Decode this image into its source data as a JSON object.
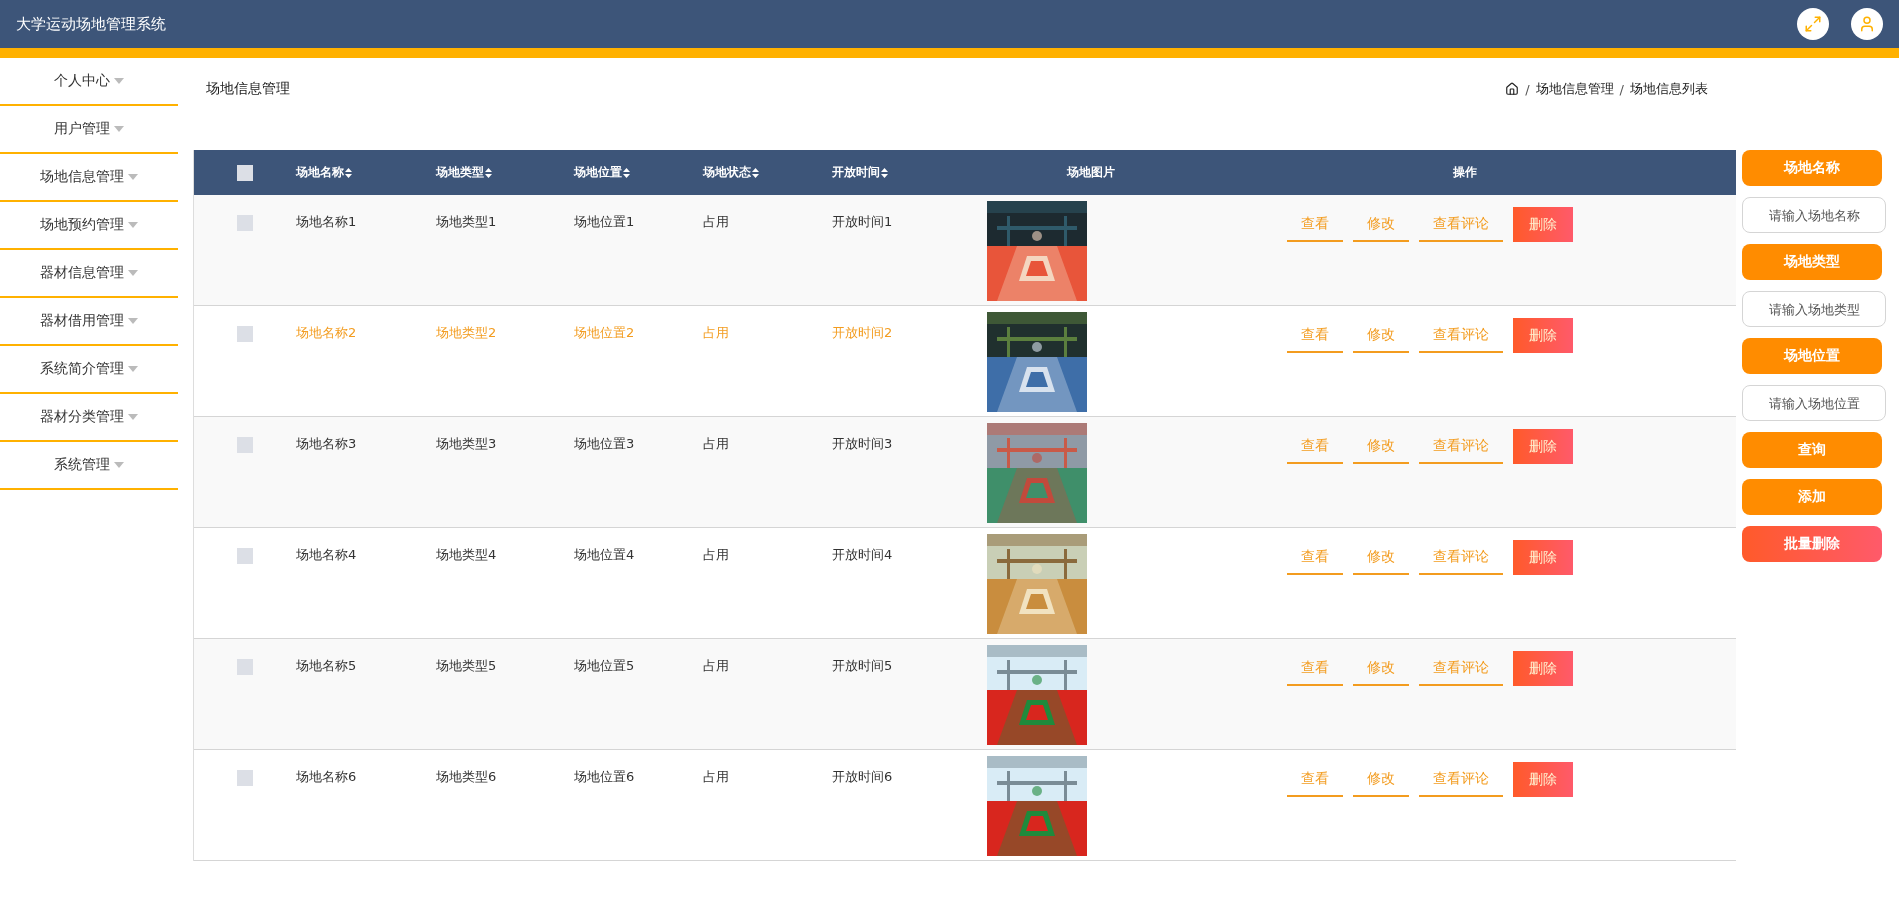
{
  "app_title": "大学运动场地管理系统",
  "sidebar": {
    "items": [
      {
        "label": "个人中心"
      },
      {
        "label": "用户管理"
      },
      {
        "label": "场地信息管理"
      },
      {
        "label": "场地预约管理"
      },
      {
        "label": "器材信息管理"
      },
      {
        "label": "器材借用管理"
      },
      {
        "label": "系统简介管理"
      },
      {
        "label": "器材分类管理"
      },
      {
        "label": "系统管理"
      }
    ]
  },
  "page_title": "场地信息管理",
  "breadcrumb": [
    "场地信息管理",
    "场地信息列表"
  ],
  "breadcrumb_separator": "/",
  "table": {
    "select_all_checked": false,
    "columns": [
      {
        "label": "场地名称",
        "sortable": true
      },
      {
        "label": "场地类型",
        "sortable": true
      },
      {
        "label": "场地位置",
        "sortable": true
      },
      {
        "label": "场地状态",
        "sortable": true
      },
      {
        "label": "开放时间",
        "sortable": true
      },
      {
        "label": "场地图片",
        "sortable": false
      },
      {
        "label": "操作",
        "sortable": false
      }
    ],
    "rows": [
      {
        "checked": false,
        "hovered": false,
        "cells": [
          "场地名称1",
          "场地类型1",
          "场地位置1",
          "占用",
          "开放时间1"
        ],
        "picture": {
          "kind": "picture"
        },
        "actions": [
          "查看",
          "修改",
          "查看评论",
          "删除"
        ]
      },
      {
        "checked": false,
        "hovered": true,
        "cells": [
          "场地名称2",
          "场地类型2",
          "场地位置2",
          "占用",
          "开放时间2"
        ],
        "picture": {
          "kind": "picture"
        },
        "actions": [
          "查看",
          "修改",
          "查看评论",
          "删除"
        ]
      },
      {
        "checked": false,
        "hovered": false,
        "cells": [
          "场地名称3",
          "场地类型3",
          "场地位置3",
          "占用",
          "开放时间3"
        ],
        "picture": {
          "kind": "picture"
        },
        "actions": [
          "查看",
          "修改",
          "查看评论",
          "删除"
        ]
      },
      {
        "checked": false,
        "hovered": false,
        "cells": [
          "场地名称4",
          "场地类型4",
          "场地位置4",
          "占用",
          "开放时间4"
        ],
        "picture": {
          "kind": "picture"
        },
        "actions": [
          "查看",
          "修改",
          "查看评论",
          "删除"
        ]
      },
      {
        "checked": false,
        "hovered": false,
        "cells": [
          "场地名称5",
          "场地类型5",
          "场地位置5",
          "占用",
          "开放时间5"
        ],
        "picture": {
          "kind": "picture"
        },
        "actions": [
          "查看",
          "修改",
          "查看评论",
          "删除"
        ]
      },
      {
        "checked": false,
        "hovered": false,
        "cells": [
          "场地名称6",
          "场地类型6",
          "场地位置6",
          "占用",
          "开放时间6"
        ],
        "picture": {
          "kind": "picture"
        },
        "actions": [
          "查看",
          "修改",
          "查看评论",
          "删除"
        ]
      }
    ]
  },
  "search_panel": {
    "fields": [
      {
        "label": "场地名称",
        "placeholder": "请输入场地名称"
      },
      {
        "label": "场地类型",
        "placeholder": "请输入场地类型"
      },
      {
        "label": "场地位置",
        "placeholder": "请输入场地位置"
      }
    ],
    "buttons": [
      {
        "label": "查询",
        "kind": "primary"
      },
      {
        "label": "添加",
        "kind": "primary"
      },
      {
        "label": "批量删除",
        "kind": "danger"
      }
    ]
  }
}
